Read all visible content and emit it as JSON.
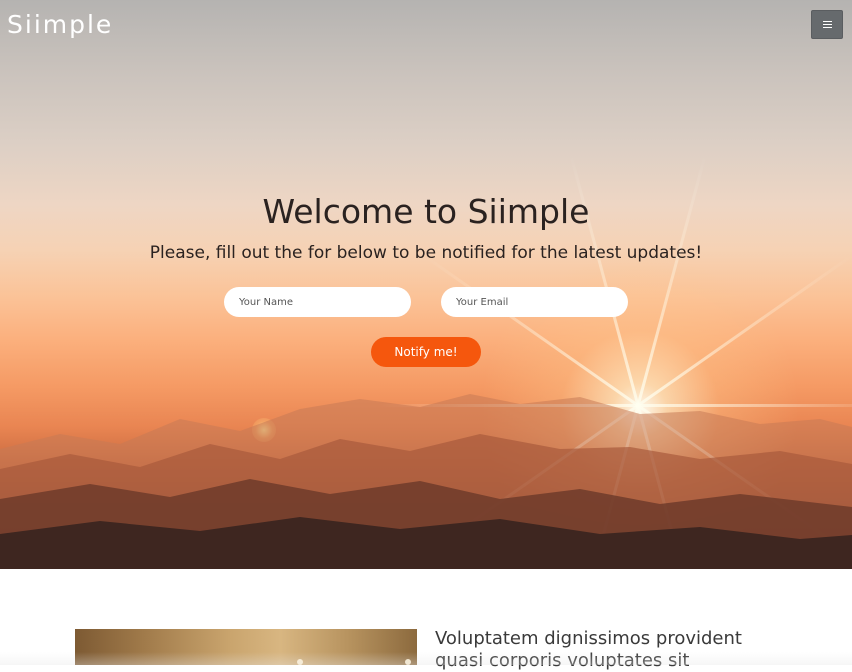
{
  "header": {
    "logo": "Siimple",
    "menu_icon": "hamburger-menu-icon"
  },
  "hero": {
    "title": "Welcome to Siimple",
    "subtitle": "Please, fill out the for below to be notified for the latest updates!",
    "form": {
      "name_placeholder": "Your Name",
      "name_value": "",
      "email_placeholder": "Your Email",
      "email_value": "",
      "submit_label": "Notify me!"
    },
    "colors": {
      "button": "#f5570d",
      "menu_button": "#666a6d"
    }
  },
  "content": {
    "text": "Voluptatem dignissimos provident quasi corporis voluptates sit"
  }
}
